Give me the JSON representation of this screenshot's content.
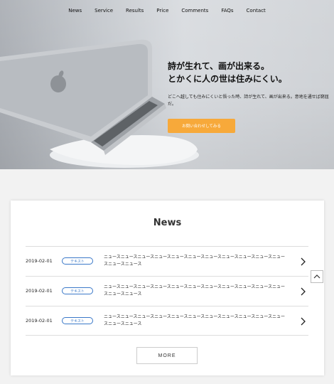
{
  "nav": {
    "items": [
      "News",
      "Service",
      "Results",
      "Price",
      "Comments",
      "FAQs",
      "Contact"
    ]
  },
  "hero": {
    "title_line1": "詩が生れて、画が出来る。",
    "title_line2": "とかくに人の世は住みにくい。",
    "text": "どこへ越しても住みにくいと悟った時、詩が生れて、画が出来る。意地を通せば窮屈だ。",
    "cta_label": "お問い合わせしてみる",
    "cta_color": "#f7a93a"
  },
  "news": {
    "title": "News",
    "items": [
      {
        "date": "2019-02-01",
        "badge": "テキスト",
        "text": "ニュースニュースニュースニュースニュースニュースニュースニュースニュースニュースニュースニュースニュース"
      },
      {
        "date": "2019-02-01",
        "badge": "テキスト",
        "text": "ニュースニュースニュースニュースニュースニュースニュースニュースニュースニュースニュースニュースニュース"
      },
      {
        "date": "2019-02-01",
        "badge": "テキスト",
        "text": "ニュースニュースニュースニュースニュースニュースニュースニュースニュースニュースニュースニュースニュース"
      }
    ],
    "more_label": "MORE",
    "badge_color": "#3a78c8"
  },
  "icons": {
    "row_arrow": "chevron-right-icon",
    "scroll_top": "chevron-up-icon"
  }
}
